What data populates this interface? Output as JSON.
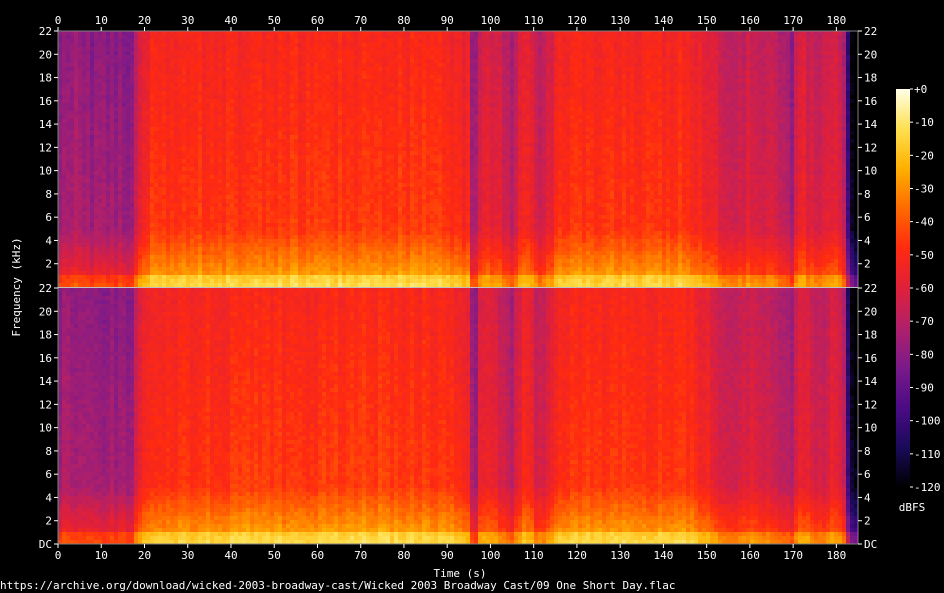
{
  "chart_data": {
    "type": "heatmap",
    "xlabel": "Time (s)",
    "ylabel": "Frequency (kHz)",
    "xlim": [
      0,
      185
    ],
    "ylim_khz": [
      0,
      22
    ],
    "x_ticks": [
      0,
      10,
      20,
      30,
      40,
      50,
      60,
      70,
      80,
      90,
      100,
      110,
      120,
      130,
      140,
      150,
      160,
      170,
      180
    ],
    "y_ticks": [
      {
        "value": 0,
        "label": "DC"
      },
      {
        "value": 2,
        "label": "2"
      },
      {
        "value": 4,
        "label": "4"
      },
      {
        "value": 6,
        "label": "6"
      },
      {
        "value": 8,
        "label": "8"
      },
      {
        "value": 10,
        "label": "10"
      },
      {
        "value": 12,
        "label": "12"
      },
      {
        "value": 14,
        "label": "14"
      },
      {
        "value": 16,
        "label": "16"
      },
      {
        "value": 18,
        "label": "18"
      },
      {
        "value": 20,
        "label": "20"
      },
      {
        "value": 22,
        "label": "22"
      }
    ],
    "channels": 2,
    "colorbar": {
      "unit": "dBFS",
      "range": [
        -120,
        0
      ],
      "ticks": [
        {
          "value": 0,
          "label": "+0"
        },
        {
          "value": -10,
          "label": "-10"
        },
        {
          "value": -20,
          "label": "-20"
        },
        {
          "value": -30,
          "label": "-30"
        },
        {
          "value": -40,
          "label": "-40"
        },
        {
          "value": -50,
          "label": "-50"
        },
        {
          "value": -60,
          "label": "-60"
        },
        {
          "value": -70,
          "label": "-70"
        },
        {
          "value": -80,
          "label": "-80"
        },
        {
          "value": -90,
          "label": "-90"
        },
        {
          "value": -100,
          "label": "-100"
        },
        {
          "value": -110,
          "label": "-110"
        },
        {
          "value": -120,
          "label": "-120"
        }
      ],
      "colors": [
        "#000000",
        "#1a0a5a",
        "#4b0b85",
        "#7a1a8a",
        "#b0206a",
        "#e0203a",
        "#ff2a10",
        "#ff6a00",
        "#ffb000",
        "#ffe050",
        "#ffffe8"
      ]
    },
    "intensity_profile": [
      {
        "t": 0,
        "level": -72
      },
      {
        "t": 3,
        "level": -70
      },
      {
        "t": 8,
        "level": -74
      },
      {
        "t": 12,
        "level": -72
      },
      {
        "t": 17,
        "level": -75
      },
      {
        "t": 19,
        "level": -52
      },
      {
        "t": 22,
        "level": -44
      },
      {
        "t": 30,
        "level": -45
      },
      {
        "t": 45,
        "level": -44
      },
      {
        "t": 60,
        "level": -44
      },
      {
        "t": 75,
        "level": -43
      },
      {
        "t": 90,
        "level": -44
      },
      {
        "t": 95,
        "level": -50
      },
      {
        "t": 96,
        "level": -80
      },
      {
        "t": 98,
        "level": -52
      },
      {
        "t": 102,
        "level": -58
      },
      {
        "t": 105,
        "level": -66
      },
      {
        "t": 108,
        "level": -48
      },
      {
        "t": 112,
        "level": -64
      },
      {
        "t": 116,
        "level": -46
      },
      {
        "t": 125,
        "level": -44
      },
      {
        "t": 135,
        "level": -45
      },
      {
        "t": 145,
        "level": -44
      },
      {
        "t": 150,
        "level": -52
      },
      {
        "t": 155,
        "level": -62
      },
      {
        "t": 160,
        "level": -58
      },
      {
        "t": 165,
        "level": -60
      },
      {
        "t": 170,
        "level": -72
      },
      {
        "t": 171,
        "level": -52
      },
      {
        "t": 176,
        "level": -62
      },
      {
        "t": 180,
        "level": -54
      },
      {
        "t": 182,
        "level": -70
      },
      {
        "t": 183,
        "level": -110
      },
      {
        "t": 185,
        "level": -120
      }
    ]
  },
  "source_url": "https://archive.org/download/wicked-2003-broadway-cast/Wicked 2003 Broadway Cast/09 One Short Day.flac"
}
